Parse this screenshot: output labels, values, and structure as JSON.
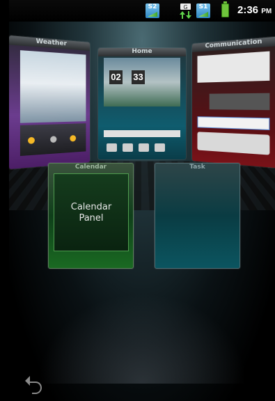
{
  "status_bar": {
    "sim1_label": "S2",
    "data_label": "G",
    "sim2_label": "S1",
    "time": "2:36",
    "ampm": "PM"
  },
  "panels": {
    "weather": {
      "title": "Weather"
    },
    "home": {
      "title": "Home",
      "clock_hour": "02",
      "clock_min": "33"
    },
    "communication": {
      "title": "Communication"
    },
    "calendar": {
      "title": "Calendar",
      "label_line1": "Calendar",
      "label_line2": "Panel"
    },
    "task": {
      "title": "Task"
    }
  },
  "colors": {
    "weather_accent": "#6b3c8e",
    "home_accent": "#0f5c6e",
    "communication_accent": "#7a1218",
    "calendar_accent": "#1a6a22",
    "task_accent": "#0b5560"
  },
  "icons": [
    "signal-icon",
    "data-transfer-icon",
    "battery-icon",
    "back-icon"
  ]
}
